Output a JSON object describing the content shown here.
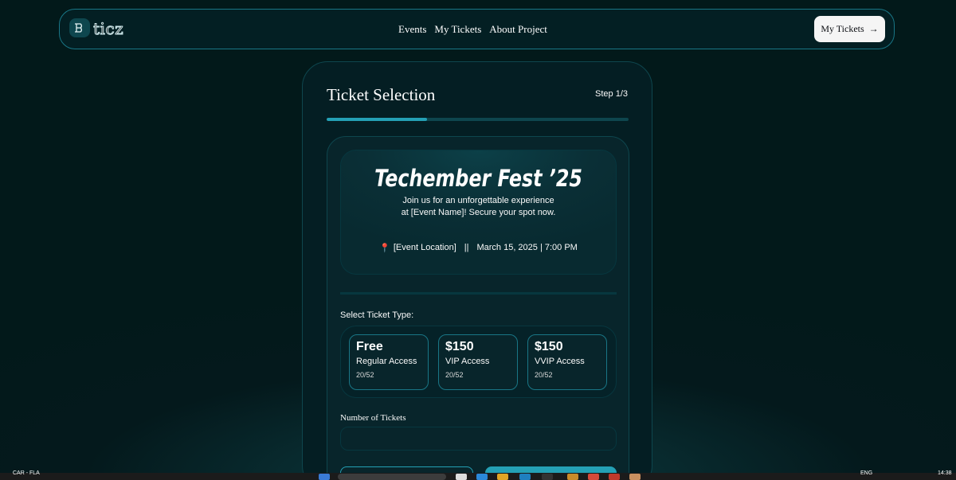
{
  "nav": {
    "logo": "ticz",
    "links": [
      "Events",
      "My Tickets",
      "About Project"
    ],
    "cta": "My Tickets",
    "cta_arrow": "→"
  },
  "card": {
    "title": "Ticket Selection",
    "step": "Step 1/3",
    "progress": 0.333
  },
  "event": {
    "title": "Techember Fest ’25",
    "description": "Join us for an unforgettable experience at [Event Name]! Secure your spot now.",
    "pin": "📍",
    "location": "[Event Location]",
    "separator": "||",
    "datetime": "March 15, 2025 | 7:00 PM"
  },
  "ticket_type": {
    "label": "Select Ticket Type:",
    "options": [
      {
        "price": "Free",
        "access": "Regular Access",
        "count": "20/52"
      },
      {
        "price": "$150",
        "access": "VIP Access",
        "count": "20/52"
      },
      {
        "price": "$150",
        "access": "VVIP Access",
        "count": "20/52"
      }
    ]
  },
  "number_of_tickets": {
    "label": "Number of Tickets",
    "value": ""
  },
  "taskbar": {
    "weather": "CAR - FLA",
    "lang": "ENG",
    "time": "14:38"
  },
  "colors": {
    "background": "#02191a",
    "accent": "#24a0b5",
    "border": "#0e464e"
  }
}
